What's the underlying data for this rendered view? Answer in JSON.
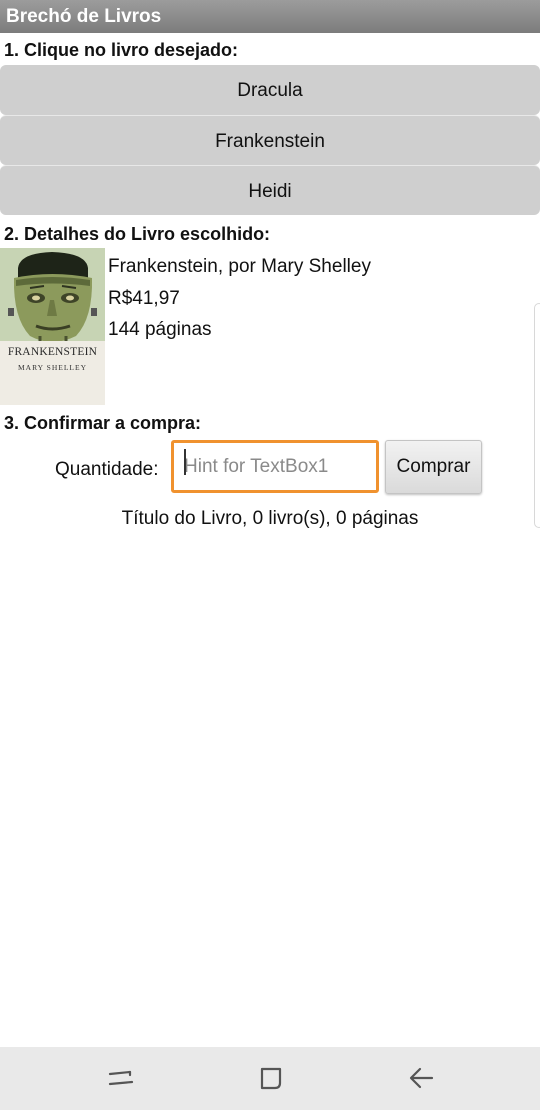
{
  "app": {
    "title": "Brechó de Livros"
  },
  "step1": {
    "heading": "1. Clique no livro desejado:",
    "books": [
      "Dracula",
      "Frankenstein",
      "Heidi"
    ]
  },
  "step2": {
    "heading": "2. Detalhes do Livro escolhido:",
    "cover": {
      "title": "FRANKENSTEIN",
      "author": "MARY SHELLEY"
    },
    "title_author": "Frankenstein, por Mary Shelley",
    "price": "R$41,97",
    "pages": "144 páginas"
  },
  "step3": {
    "heading": "3. Confirmar a compra:",
    "quantity_label": "Quantidade:",
    "quantity_value": "",
    "quantity_placeholder": "Hint for TextBox1",
    "buy_label": "Comprar",
    "summary": "Título do Livro, 0 livro(s), 0 páginas"
  },
  "navbar": {
    "icons": [
      "recent-apps-icon",
      "home-icon",
      "back-icon"
    ]
  }
}
